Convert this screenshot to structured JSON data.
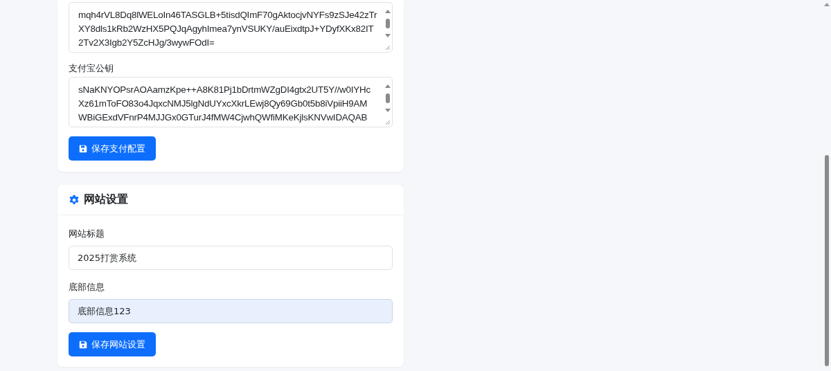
{
  "payment_card": {
    "fields": [
      {
        "kind": "textarea",
        "value": "mqh4rVL8Dq8lWELoIn46TASGLB+5tisdQImF70gAktocjvNYFs9zSJe42zTr\nXY8dls1kRb2WzHX5PQJqAgyhImea7ynVSUKY/auEixdtpJ+YDyfXKx82IT\n2Tv2X3Igb2Y5ZcHJg/3wywFOdI="
      },
      {
        "kind": "textarea",
        "label": "支付宝公钥",
        "value": "sNaKNYOPsrAOAamzKpe++A8K81Pj1bDrtmWZgDI4gtx2UT5Y//w0IYHc\nXz61mToFO83o4JqxcNMJ5lgNdUYxcXkrLEwj8Qy69Gb0t5b8iVpiiH9AM\nWBiGExdVFnrP4MJJGx0GTurJ4fMW4CjwhQWfiMKeKjlsKNVwIDAQAB"
      }
    ],
    "save_button": "保存支付配置"
  },
  "site_card": {
    "title": "网站设置",
    "fields": [
      {
        "kind": "input",
        "label": "网站标题",
        "value": "2025打赏系统",
        "focused": false
      },
      {
        "kind": "input",
        "label": "底部信息",
        "value": "底部信息123",
        "focused": true
      }
    ],
    "save_button": "保存网站设置"
  }
}
